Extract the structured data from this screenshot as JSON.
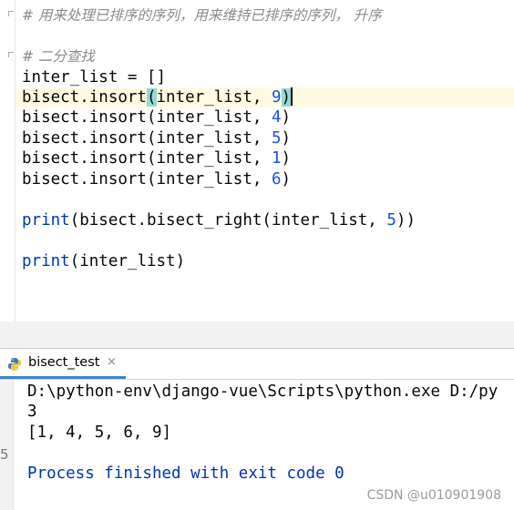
{
  "editor": {
    "comment1": "# 用来处理已排序的序列，用来维持已排序的序列， 升序",
    "comment2": "# 二分查找",
    "lines": [
      "inter_list = []",
      "bisect.insort(inter_list, 9)",
      "bisect.insort(inter_list, 4)",
      "bisect.insort(inter_list, 5)",
      "bisect.insort(inter_list, 1)",
      "bisect.insort(inter_list, 6)",
      "print(bisect.bisect_right(inter_list, 5))",
      "print(inter_list)"
    ]
  },
  "run_panel": {
    "tab_label": "bisect_test",
    "close_glyph": "×",
    "tab_icon": "python-icon",
    "gutter_digit": "5"
  },
  "console": {
    "command": "D:\\python-env\\django-vue\\Scripts\\python.exe D:/py",
    "output1": "3",
    "output2": "[1, 4, 5, 6, 9]",
    "exit_message": "Process finished with exit code 0"
  },
  "watermark": "CSDN @u010901908",
  "colors": {
    "comment": "#8c8c8c",
    "keyword_builtin": "#0033b3",
    "number": "#1750eb",
    "caret_line": "#fffae3",
    "brace_match": "#93d9d9",
    "tab_underline": "#4083c9"
  }
}
